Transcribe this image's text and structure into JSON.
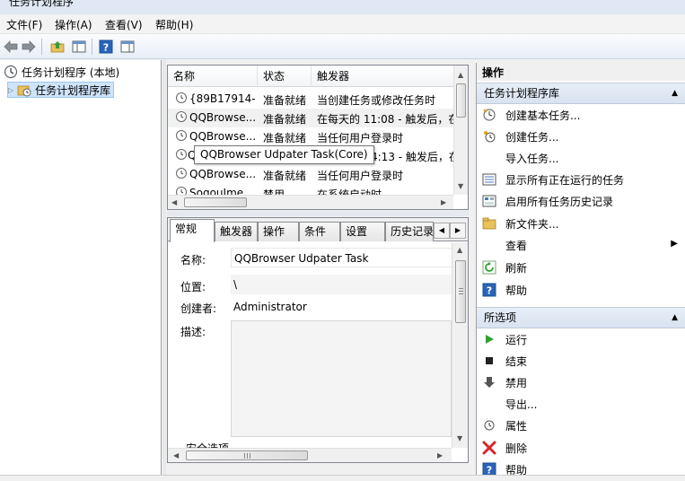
{
  "window": {
    "title": "任务计划程序"
  },
  "menu": [
    {
      "label": "文件(F)"
    },
    {
      "label": "操作(A)"
    },
    {
      "label": "查看(V)"
    },
    {
      "label": "帮助(H)"
    }
  ],
  "toolbar": {
    "icons": [
      "back-icon",
      "forward-icon",
      "up-folder-icon",
      "show-hide-tree-icon",
      "help-icon",
      "show-hide-action-pane-icon"
    ]
  },
  "tree": {
    "root": "任务计划程序 (本地)",
    "library": "任务计划程序库"
  },
  "task_list": {
    "columns": [
      "名称",
      "状态",
      "触发器"
    ],
    "rows": [
      {
        "name": "{89B17914-...",
        "status": "准备就绪",
        "trigger": "当创建任务或修改任务时"
      },
      {
        "name": "QQBrowse...",
        "status": "准备就绪",
        "trigger": "在每天的 11:08 - 触发后，在"
      },
      {
        "name": "QQBrowse...",
        "status": "准备就绪",
        "trigger": "当任何用户登录时"
      },
      {
        "name": "Q",
        "status": "",
        "trigger": "4:13 - 触发后，在"
      },
      {
        "name": "QQBrowse...",
        "status": "准备就绪",
        "trigger": "当任何用户登录时"
      },
      {
        "name": "SogouIme...",
        "status": "禁用",
        "trigger": "在系统启动时"
      }
    ],
    "tooltip": "QQBrowser Udpater Task(Core)"
  },
  "details": {
    "tabs": [
      "常规",
      "触发器",
      "操作",
      "条件",
      "设置",
      "历史记录"
    ],
    "name_label": "名称:",
    "name_value": "QQBrowser Udpater Task",
    "location_label": "位置:",
    "location_value": "\\",
    "author_label": "创建者:",
    "author_value": "Administrator",
    "desc_label": "描述:",
    "security_label": "安全选项"
  },
  "actions_pane": {
    "title": "操作",
    "section1": {
      "title": "任务计划程序库",
      "items": [
        {
          "label": "创建基本任务...",
          "icon": "create-basic-task-icon"
        },
        {
          "label": "创建任务...",
          "icon": "create-task-icon"
        },
        {
          "label": "导入任务...",
          "icon": ""
        },
        {
          "label": "显示所有正在运行的任务",
          "icon": "running-tasks-icon"
        },
        {
          "label": "启用所有任务历史记录",
          "icon": "history-icon"
        },
        {
          "label": "新文件夹...",
          "icon": "new-folder-icon"
        },
        {
          "label": "查看",
          "icon": ""
        },
        {
          "label": "刷新",
          "icon": "refresh-icon"
        },
        {
          "label": "帮助",
          "icon": "help-icon"
        }
      ]
    },
    "section2": {
      "title": "所选项",
      "items": [
        {
          "label": "运行",
          "icon": "run-icon"
        },
        {
          "label": "结束",
          "icon": "stop-icon"
        },
        {
          "label": "禁用",
          "icon": "disable-icon"
        },
        {
          "label": "导出...",
          "icon": ""
        },
        {
          "label": "属性",
          "icon": "properties-icon"
        },
        {
          "label": "删除",
          "icon": "delete-icon"
        },
        {
          "label": "帮助",
          "icon": "help-icon"
        }
      ]
    }
  },
  "colors": {
    "accent_blue": "#2a64b8",
    "selection": "#cfe4fa",
    "delete_red": "#d8262a",
    "run_green": "#2ea12e"
  }
}
